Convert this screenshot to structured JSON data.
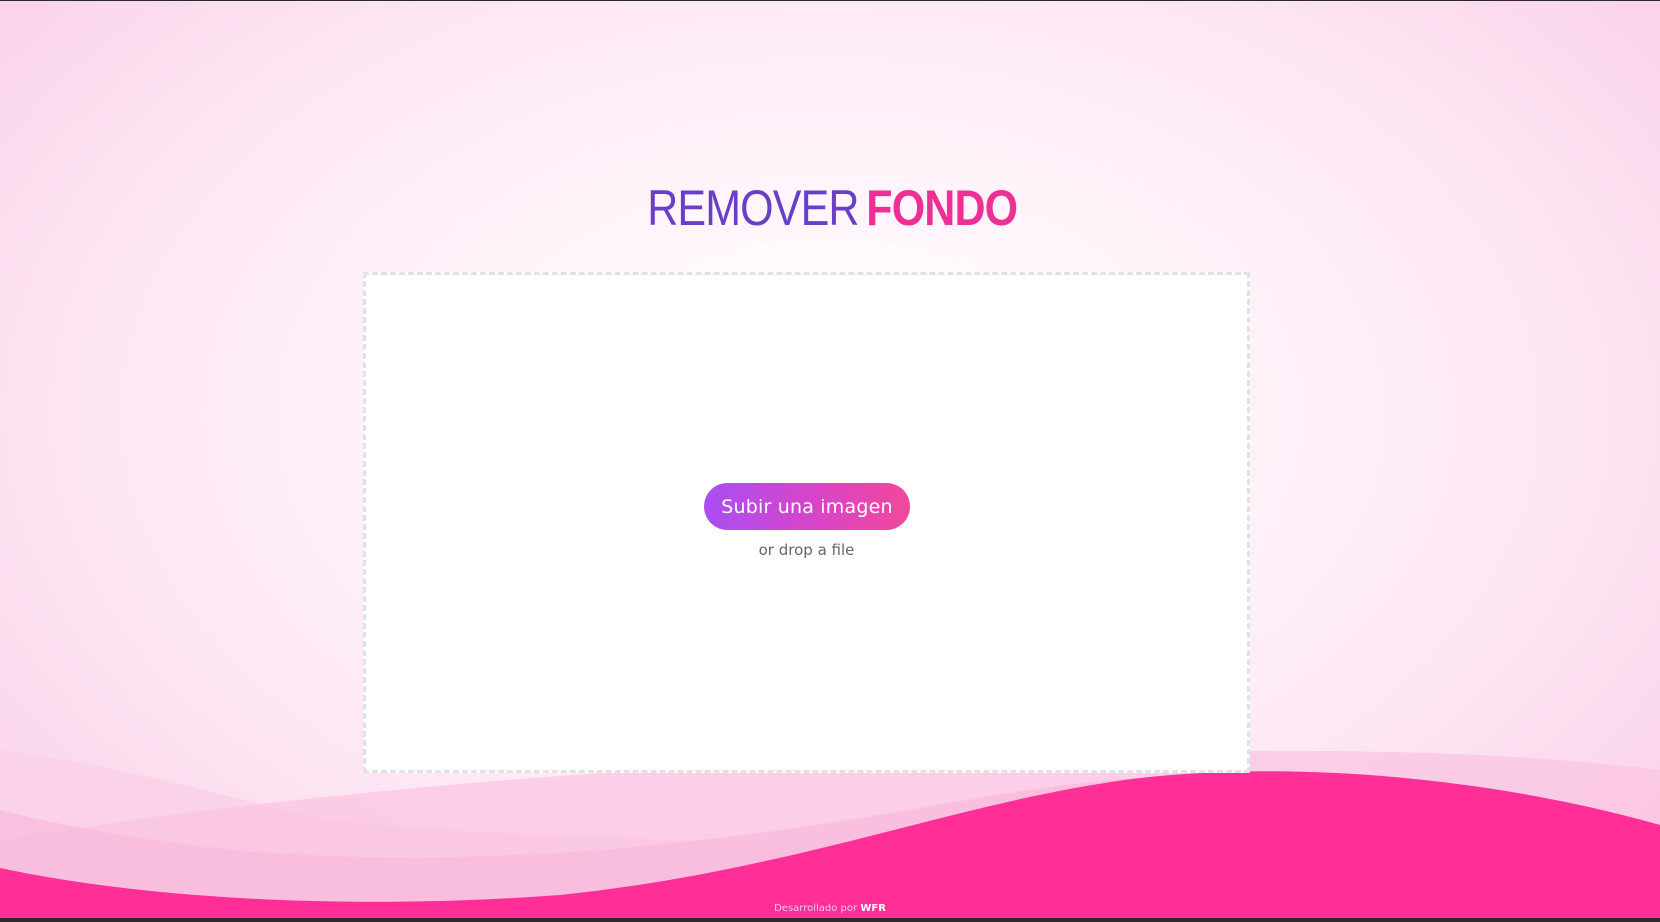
{
  "logo": {
    "light": "REMOVER",
    "bold": "FONDO"
  },
  "upload": {
    "button_label": "Subir una imagen",
    "drop_hint": "or drop a file"
  },
  "footer": {
    "credit_prefix": "Desarrollado por",
    "credit_brand": "WFR"
  },
  "colors": {
    "logo_light": "#6a3fc8",
    "logo_bold": "#ee2f96",
    "button_gradient_start": "#a84ef2",
    "button_gradient_end": "#f2489b",
    "wave_primary": "#ff2f97",
    "wave_light": "#fbc7e2"
  },
  "icons": []
}
